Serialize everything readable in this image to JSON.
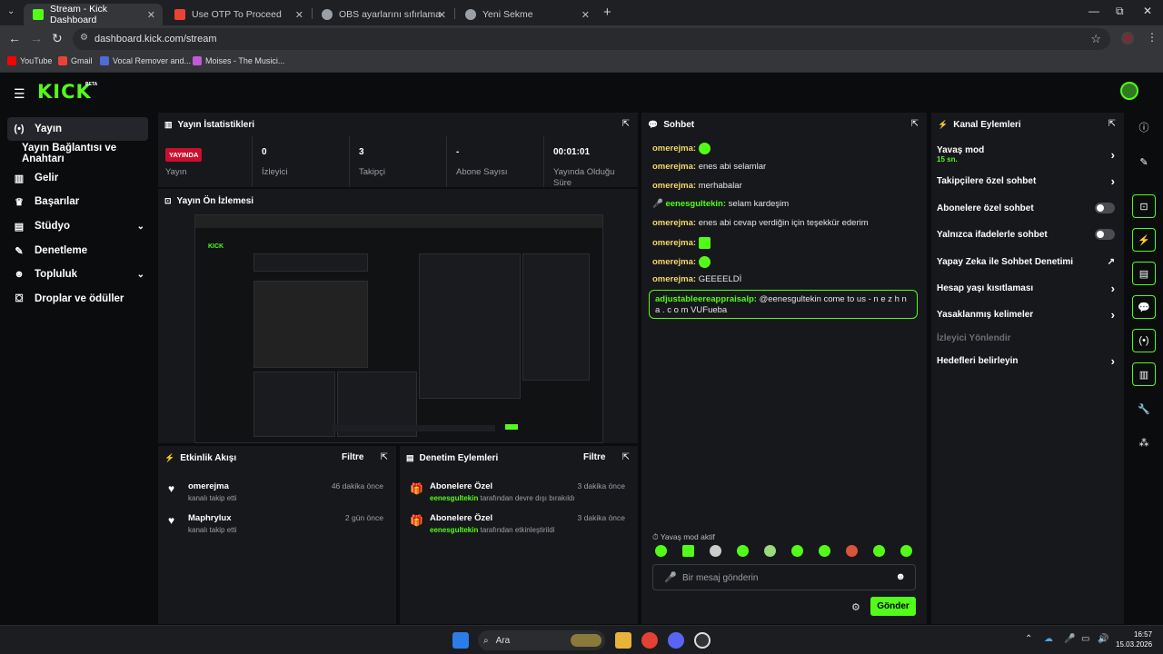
{
  "browser": {
    "tabs": [
      {
        "title": "Stream - Kick Dashboard",
        "active": true,
        "favicon_color": "#53fc18"
      },
      {
        "title": "Use OTP To Proceed - enesg84…",
        "active": false,
        "favicon_color": "#ea4335"
      },
      {
        "title": "OBS ayarlarını sıfırlama",
        "active": false,
        "favicon_color": "#9aa0a6"
      },
      {
        "title": "Yeni Sekme",
        "active": false,
        "favicon_color": "#9aa0a6"
      }
    ],
    "new_tab_label": "+",
    "window_controls": {
      "minimize": "—",
      "maximize": "⧉",
      "close": "✕"
    },
    "address": "dashboard.kick.com/stream",
    "bookmarks": [
      {
        "label": "YouTube",
        "icon_color": "#ff0000"
      },
      {
        "label": "Gmail",
        "icon_color": "#ea4335"
      },
      {
        "label": "Vocal Remover and...",
        "icon_color": "#4f6bd8"
      },
      {
        "label": "Moises - The Musici...",
        "icon_color": "#c25ad8"
      }
    ]
  },
  "kick": {
    "logo": "KICK",
    "logo_badge": "BETA",
    "accent": "#53fc18",
    "sidebar": [
      {
        "label": "Yayın",
        "icon": "broadcast-icon",
        "glyph": "(•)",
        "active": true
      },
      {
        "label": "Yayın Bağlantısı ve Anahtarı",
        "icon": "",
        "glyph": "",
        "active": false
      },
      {
        "label": "Gelir",
        "icon": "revenue-icon",
        "glyph": "▥",
        "active": false
      },
      {
        "label": "Başarılar",
        "icon": "trophy-icon",
        "glyph": "🏆",
        "active": false
      },
      {
        "label": "Stüdyo",
        "icon": "studio-icon",
        "glyph": "▤",
        "active": false,
        "chevron": "⌄"
      },
      {
        "label": "Denetleme",
        "icon": "wrench-icon",
        "glyph": "🔧",
        "active": false
      },
      {
        "label": "Topluluk",
        "icon": "community-icon",
        "glyph": "👥",
        "active": false,
        "chevron": "⌄"
      },
      {
        "label": "Droplar ve ödüller",
        "icon": "drops-icon",
        "glyph": "⛋",
        "active": false
      }
    ],
    "stats": {
      "title": "Yayın İstatistikleri",
      "live_badge": "YAYINDA",
      "live_label": "Yayın",
      "items": [
        {
          "value": "0",
          "label": "İzleyici"
        },
        {
          "value": "3",
          "label": "Takipçi"
        },
        {
          "value": "-",
          "label": "Abone Sayısı"
        },
        {
          "value": "00:01:01",
          "label": "Yayında Olduğu Süre"
        }
      ]
    },
    "preview": {
      "title": "Yayın Ön İzlemesi"
    },
    "events": {
      "title": "Etkinlik Akışı",
      "filter": "Filtre",
      "items": [
        {
          "name": "omerejma",
          "sub": "kanalı takip etti",
          "time": "46 dakika önce"
        },
        {
          "name": "Maphrylux",
          "sub": "kanalı takip etti",
          "time": "2 gün önce"
        }
      ]
    },
    "moderation": {
      "title": "Denetim Eylemleri",
      "filter": "Filtre",
      "items": [
        {
          "name": "Abonelere Özel",
          "user": "eenesgultekin",
          "sub": "tarafından devre dışı bırakıldı",
          "time": "3 dakika önce"
        },
        {
          "name": "Abonelere Özel",
          "user": "eenesgultekin",
          "sub": "tarafından etkinleştirildi",
          "time": "3 dakika önce"
        }
      ]
    },
    "chat": {
      "title": "Sohbet",
      "messages": [
        {
          "user": "omerejma:",
          "text": "",
          "emote": true,
          "user_color": "#f5d76e"
        },
        {
          "user": "omerejma:",
          "text": "enes abi selamlar",
          "emote": false,
          "user_color": "#f5d76e"
        },
        {
          "user": "omerejma:",
          "text": "merhabalar",
          "emote": false,
          "user_color": "#f5d76e"
        },
        {
          "user": "eenesgultekin:",
          "text": "selam kardeşim",
          "emote": false,
          "user_color": "#53fc18",
          "mic": true
        },
        {
          "user": "omerejma:",
          "text": "enes abi cevap verdiğin için teşekkür ederim",
          "emote": false,
          "user_color": "#f5d76e"
        },
        {
          "user": "omerejma:",
          "text": "",
          "emote": true,
          "user_color": "#f5d76e"
        },
        {
          "user": "omerejma:",
          "text": "",
          "emote": true,
          "user_color": "#f5d76e"
        },
        {
          "user": "omerejma:",
          "text": "GEEEELDİ",
          "emote": false,
          "user_color": "#f5d76e"
        }
      ],
      "highlight": {
        "user": "adjustableereappraisalp:",
        "text": "@eenesgultekin come to us - n e z h n a . c o m VUFueba"
      },
      "slow_mode": "Yavaş mod aktif",
      "placeholder": "Bir mesaj gönderin",
      "send": "Gönder"
    },
    "channel_actions": {
      "title": "Kanal Eylemleri",
      "items": [
        {
          "label": "Yavaş mod",
          "sub": "15 sn.",
          "control": "arrow"
        },
        {
          "label": "Takipçilere özel sohbet",
          "control": "arrow"
        },
        {
          "label": "Abonelere özel sohbet",
          "control": "toggle"
        },
        {
          "label": "Yalnızca ifadelerle sohbet",
          "control": "toggle"
        },
        {
          "label": "Yapay Zeka ile Sohbet Denetimi",
          "control": "external"
        },
        {
          "label": "Hesap yaşı kısıtlaması",
          "control": "arrow"
        },
        {
          "label": "Yasaklanmış kelimeler",
          "control": "arrow"
        },
        {
          "label": "İzleyici Yönlendir",
          "control": "none",
          "disabled": true
        },
        {
          "label": "Hedefleri belirleyin",
          "control": "arrow"
        }
      ]
    }
  },
  "taskbar": {
    "search": "Ara",
    "time": "16:57",
    "date": "15.03.2026"
  }
}
